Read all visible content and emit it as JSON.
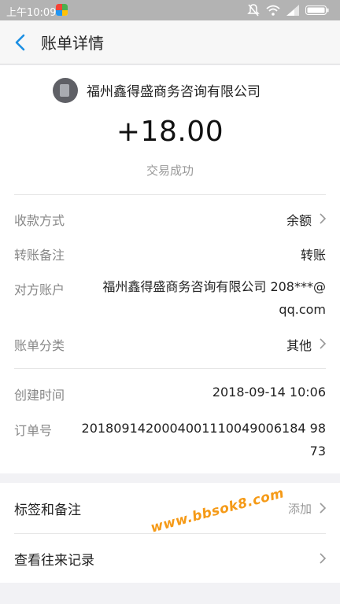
{
  "status_bar": {
    "time": "上午10:09",
    "icons": [
      "mute-icon",
      "wifi-icon",
      "signal-icon",
      "battery-icon"
    ]
  },
  "nav": {
    "title": "账单详情",
    "back_icon": "chevron-left-icon",
    "accent_color": "#1a8fe3"
  },
  "summary": {
    "merchant_name": "福州鑫得盛商务咨询有限公司",
    "amount": "+18.00",
    "status": "交易成功"
  },
  "details": [
    {
      "label": "收款方式",
      "value": "余额",
      "has_chevron": true
    },
    {
      "label": "转账备注",
      "value": "转账",
      "has_chevron": false
    },
    {
      "label": "对方账户",
      "value_line1": "福州鑫得盛商务咨询有限公司 208***@",
      "value_line2": "qq.com",
      "has_chevron": false
    },
    {
      "label": "账单分类",
      "value": "其他",
      "has_chevron": true
    },
    {
      "label": "创建时间",
      "value": "2018-09-14 10:06",
      "has_chevron": false
    },
    {
      "label": "订单号",
      "value_line1": "2018091420004001110049006184 98",
      "value_line2": "73",
      "has_chevron": false
    }
  ],
  "actions": [
    {
      "label": "标签和备注",
      "value": "添加",
      "has_chevron": true
    },
    {
      "label": "查看往来记录",
      "value": "",
      "has_chevron": true
    }
  ],
  "watermark": "www.bbsok8.com"
}
